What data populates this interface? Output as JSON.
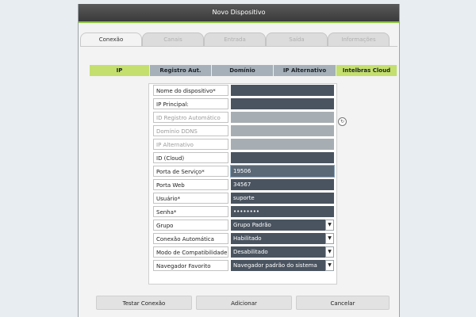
{
  "window": {
    "title": "Novo Dispositivo"
  },
  "tabs": [
    {
      "label": "Conexão",
      "active": true
    },
    {
      "label": "Canais",
      "active": false
    },
    {
      "label": "Entrada",
      "active": false
    },
    {
      "label": "Saída",
      "active": false
    },
    {
      "label": "Informações",
      "active": false
    }
  ],
  "subtabs": [
    "IP",
    "Registro Aut.",
    "Domínio",
    "IP Alternativo",
    "Intelbras Cloud"
  ],
  "form": {
    "device_name": {
      "label": "Nome do dispositivo*",
      "value": ""
    },
    "main_ip": {
      "label": "IP Principal:",
      "value": ""
    },
    "auto_register_id": {
      "label": "ID Registro Automático",
      "value": ""
    },
    "ddns_domain": {
      "label": "Domínio DDNS",
      "value": ""
    },
    "alternative_ip": {
      "label": "IP Alternativo",
      "value": ""
    },
    "cloud_id": {
      "label": "ID (Cloud)",
      "value": ""
    },
    "service_port": {
      "label": "Porta de Serviço*",
      "value": "19506"
    },
    "web_port": {
      "label": "Porta Web",
      "value": "34567"
    },
    "user": {
      "label": "Usuário*",
      "value": "suporte"
    },
    "password": {
      "label": "Senha*",
      "value": "••••••••"
    },
    "group": {
      "label": "Grupo",
      "value": "Grupo Padrão"
    },
    "auto_connect": {
      "label": "Conexão Automática",
      "value": "Habilitado"
    },
    "compat_mode": {
      "label": "Modo de Compatibilidade",
      "value": "Desabilitado"
    },
    "browser": {
      "label": "Navegador Favorito",
      "value": "Navegador padrão do sistema"
    }
  },
  "buttons": {
    "test": "Testar Conexão",
    "add": "Adicionar",
    "cancel": "Cancelar"
  },
  "icons": {
    "refresh": "refresh-icon",
    "dropdown": "chevron-down-icon"
  },
  "colors": {
    "accent": "#8cc63f",
    "field": "#4a5460",
    "field_disabled": "#a7aeb3",
    "subtab": "#a5b0b8",
    "subtab_active": "#c4df6d"
  }
}
